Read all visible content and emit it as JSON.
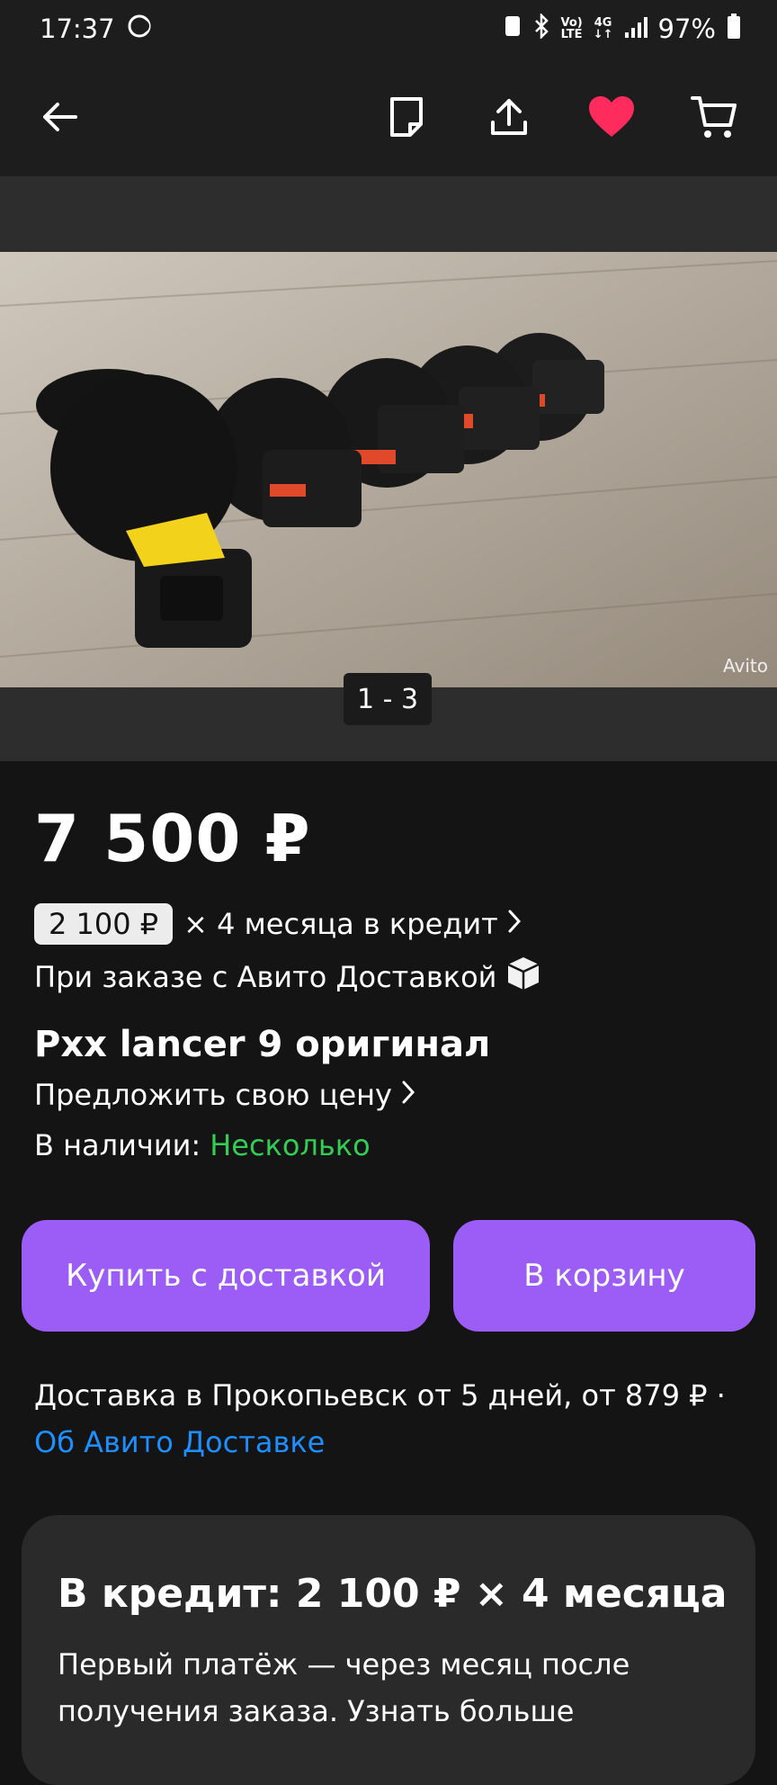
{
  "status_bar": {
    "time": "17:37",
    "volte_top": "Vo)",
    "volte_bottom": "LTE",
    "net_top": "4G",
    "net_bottom": "↓↑",
    "battery": "97%"
  },
  "icons": {
    "back": "arrow-left-icon",
    "note": "note-icon",
    "share": "share-icon",
    "favorite": "heart-icon",
    "cart": "cart-icon",
    "favorite_color": "#ff2b5c"
  },
  "gallery": {
    "counter": "1 - 3",
    "watermark": "Avito"
  },
  "product": {
    "price": "7 500 ₽",
    "credit_amount": "2 100 ₽",
    "credit_text": "× 4 месяца в кредит",
    "delivery_note": "При заказе с Авито Доставкой",
    "title": "Pxx lancer 9 оригинал",
    "offer_price": "Предложить свою цену",
    "in_stock_label": "В наличии:",
    "in_stock_value": "Несколько"
  },
  "buttons": {
    "buy_delivery": "Купить с доставкой",
    "to_cart": "В корзину",
    "accent": "#9b5df6"
  },
  "delivery": {
    "text": "Доставка в Прокопьевск от 5 дней, от 879 ₽ ·",
    "link": "Об Авито Доставке"
  },
  "credit_card": {
    "title": "В кредит: 2 100 ₽ × 4 месяца",
    "text": "Первый платёж — через месяц после получения заказа. Узнать больше"
  }
}
